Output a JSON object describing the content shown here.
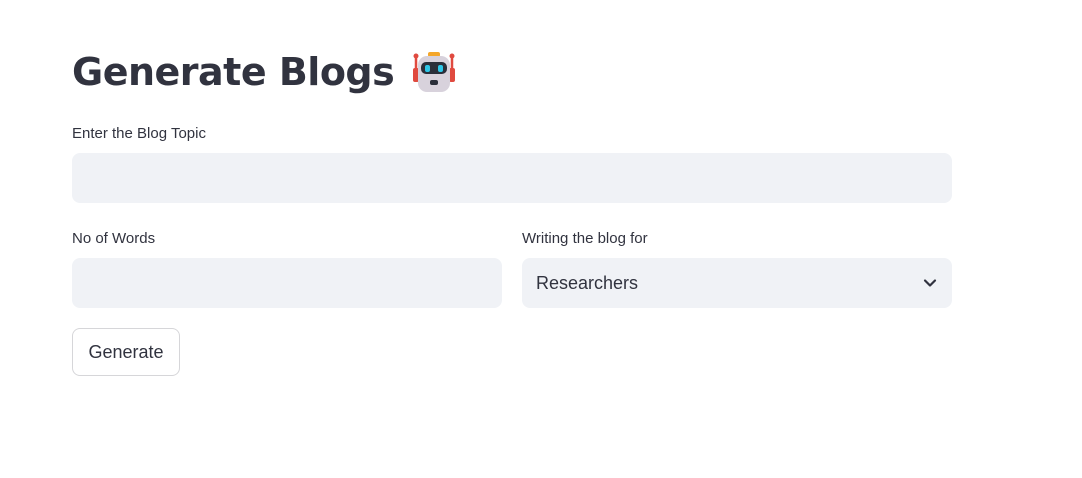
{
  "page": {
    "title": "Generate Blogs",
    "title_icon": "robot-icon"
  },
  "form": {
    "topic": {
      "label": "Enter the Blog Topic",
      "value": "",
      "placeholder": ""
    },
    "words": {
      "label": "No of Words",
      "value": "",
      "placeholder": ""
    },
    "audience": {
      "label": "Writing the blog for",
      "selected": "Researchers",
      "icon": "chevron-down-icon"
    },
    "submit": {
      "label": "Generate"
    }
  },
  "colors": {
    "text": "#31333f",
    "input_bg": "#f0f2f6",
    "button_border": "#d6d6d9",
    "background": "#ffffff"
  }
}
